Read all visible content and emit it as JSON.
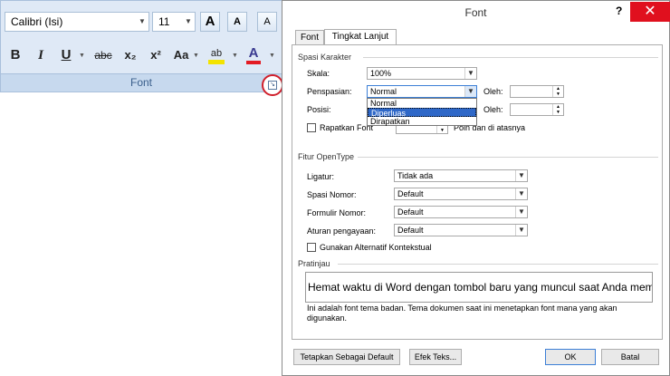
{
  "ribbon": {
    "font_name": "Calibri (Isi)",
    "font_size": "11",
    "grow_glyph": "A",
    "shrink_glyph": "A",
    "clear_glyph": "A",
    "bold": "B",
    "italic": "I",
    "underline": "U",
    "strike": "abc",
    "subscript": "x₂",
    "superscript": "x²",
    "change_case": "Aa",
    "highlight": "ab",
    "font_color": "A",
    "group_label": "Font",
    "highlight_color": "#f3e300",
    "font_color_bar": "#e31b23"
  },
  "dialog": {
    "title": "Font",
    "help": "?",
    "close": "✕",
    "tabs": [
      "Font",
      "Tingkat Lanjut"
    ],
    "spacing_section": "Spasi Karakter",
    "scale_label": "Skala:",
    "scale_value": "100%",
    "spacing_label": "Penspasian:",
    "spacing_value": "Normal",
    "by_label_1": "Oleh:",
    "by_label_2": "Oleh:",
    "position_label": "Posisi:",
    "kerning_label": "Rapatkan Font",
    "kerning_suffix": "Poin dan di atasnya",
    "dropdown_options": [
      "Normal",
      "Diperluas",
      "Dirapatkan"
    ],
    "selected_option": "Diperluas",
    "opentype_section": "Fitur OpenType",
    "ligatures_label": "Ligatur:",
    "ligatures_value": "Tidak ada",
    "num_spacing_label": "Spasi Nomor:",
    "num_spacing_value": "Default",
    "num_forms_label": "Formulir Nomor:",
    "num_forms_value": "Default",
    "stylistic_label": "Aturan pengayaan:",
    "stylistic_value": "Default",
    "contextual_label": "Gunakan Alternatif Kontekstual",
    "preview_section": "Pratinjau",
    "preview_text": "Hemat waktu di Word dengan tombol baru yang muncul saat Anda membutuhkannya",
    "note": "Ini adalah font tema badan. Tema dokumen saat ini menetapkan font mana yang akan digunakan.",
    "set_default": "Tetapkan Sebagai Default",
    "text_effects": "Efek Teks...",
    "ok": "OK",
    "cancel": "Batal",
    "close_color": "#e0101e"
  }
}
